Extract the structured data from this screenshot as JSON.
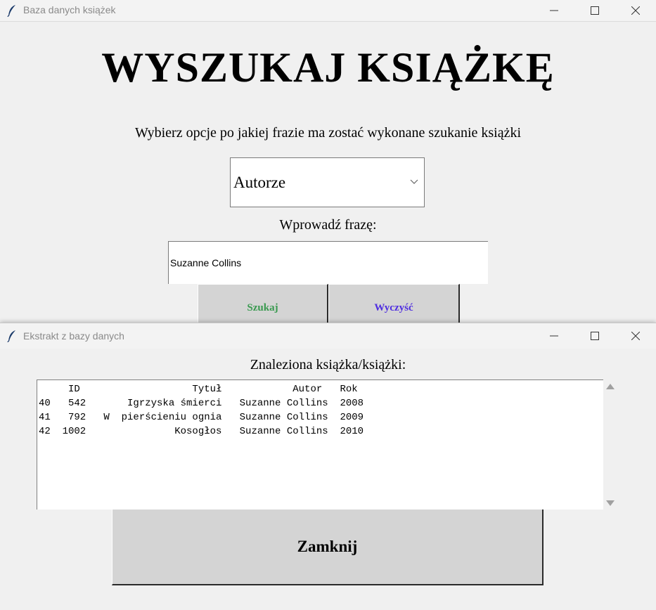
{
  "main_window": {
    "title": "Baza danych książek",
    "heading": "WYSZUKAJ KSIĄŻKĘ",
    "subtitle": "Wybierz opcje po jakiej frazie ma zostać wykonane szukanie książki",
    "search_by_select": {
      "selected": "Autorze"
    },
    "phrase_label": "Wprowadź frazę:",
    "phrase_input": {
      "value": "Suzanne Collins"
    },
    "search_button": {
      "label": "Szukaj",
      "color": "#3a9a50"
    },
    "clear_button": {
      "label": "Wyczyść",
      "color": "#4f2ee0"
    }
  },
  "extract_window": {
    "title": "Ekstrakt z bazy danych",
    "found_label": "Znaleziona książka/książki:",
    "results": {
      "header": "     ID                   Tytuł            Autor   Rok",
      "rows": [
        "40   542       Igrzyska śmierci   Suzanne Collins  2008",
        "41   792   W  pierścieniu ognia   Suzanne Collins  2009",
        "42  1002               Kosogłos   Suzanne Collins  2010"
      ]
    },
    "close_button": {
      "label": "Zamknij"
    }
  },
  "icons": {
    "app_icon": "feather-icon",
    "minimize": "minimize-icon",
    "maximize": "maximize-icon",
    "close": "close-icon"
  }
}
